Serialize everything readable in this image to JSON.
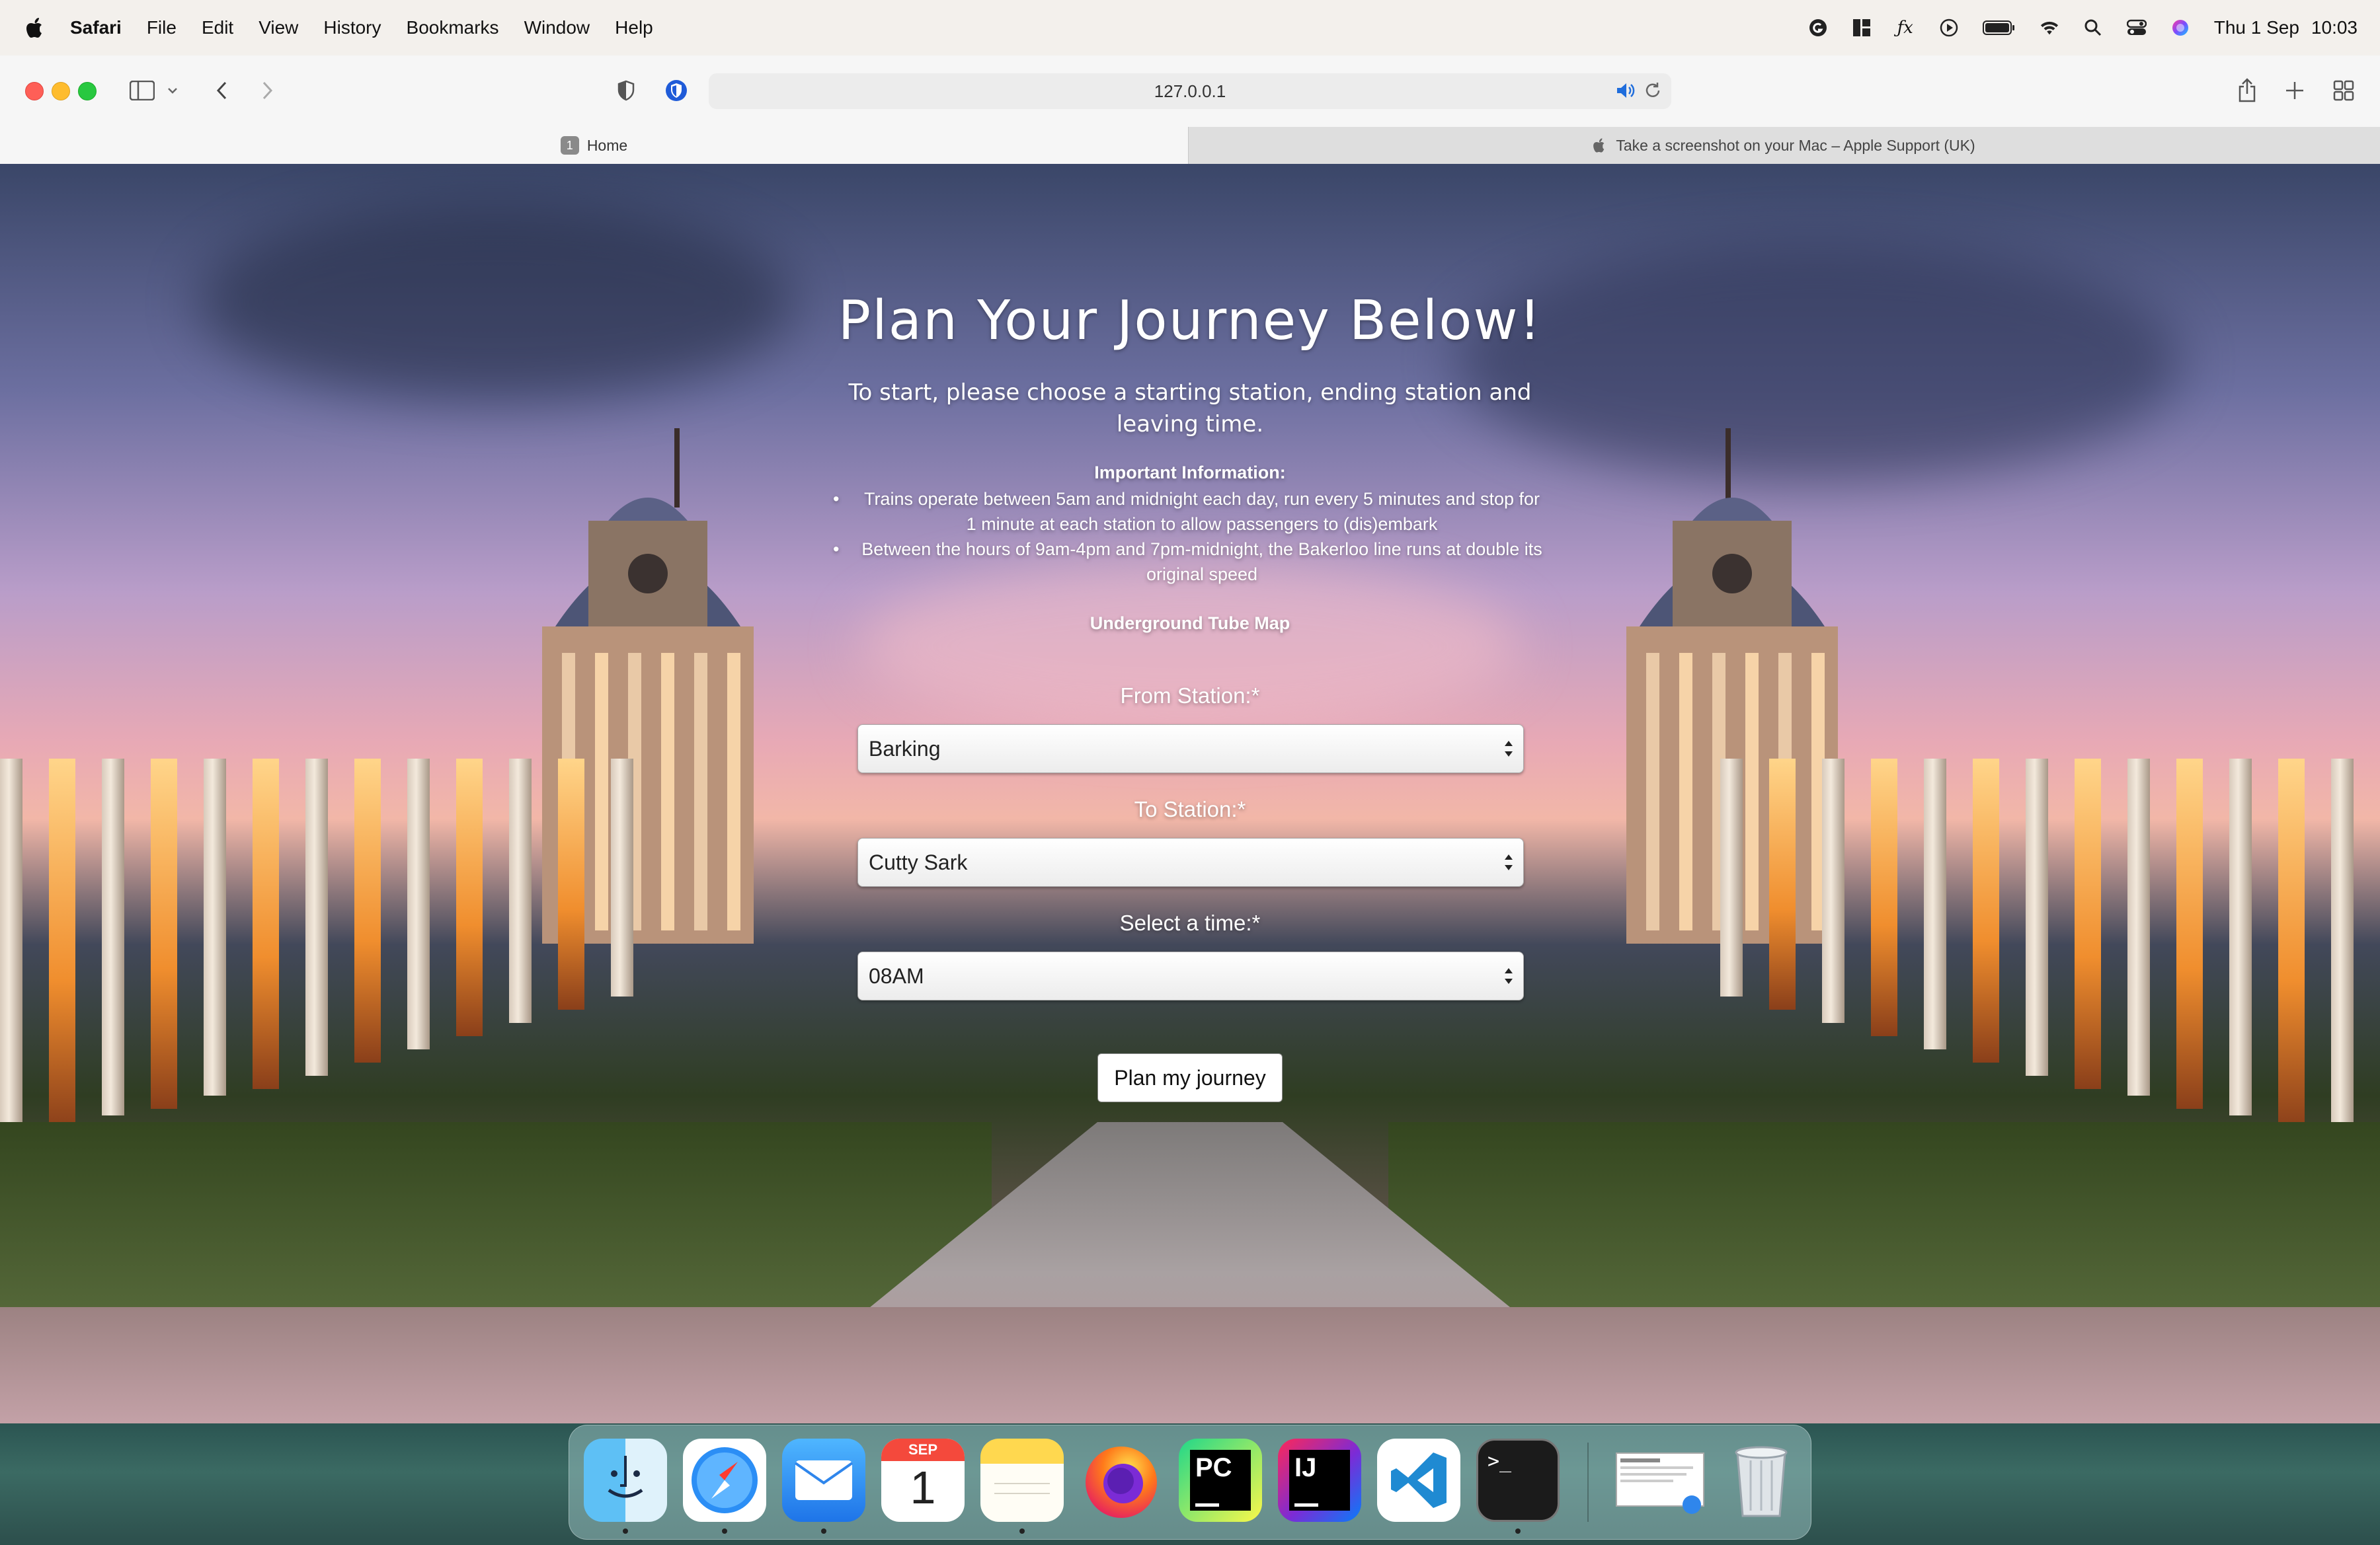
{
  "menubar": {
    "app_name": "Safari",
    "items": [
      "File",
      "Edit",
      "View",
      "History",
      "Bookmarks",
      "Window",
      "Help"
    ],
    "status_icons": [
      "grammarly-icon",
      "widgets-icon",
      "fx-icon",
      "play-icon",
      "battery-icon",
      "wifi-icon",
      "search-icon",
      "control-center-icon",
      "siri-icon"
    ],
    "date": "Thu 1 Sep",
    "time": "10:03"
  },
  "browser": {
    "url": "127.0.0.1",
    "tabs": [
      {
        "badge": "1",
        "label": "Home",
        "active": true
      },
      {
        "label": "Take a screenshot on your Mac – Apple Support (UK)",
        "active": false
      }
    ]
  },
  "page": {
    "heading": "Plan Your Journey Below!",
    "subtitle": "To start, please choose a starting station, ending station and leaving time.",
    "info_title": "Important Information:",
    "info_items": [
      "Trains operate between 5am and midnight each day, run every 5 minutes and stop for 1 minute at each station to allow passengers to (dis)embark",
      "Between the hours of 9am-4pm and 7pm-midnight, the Bakerloo line runs at double its original speed"
    ],
    "map_link": "Underground Tube Map",
    "form": {
      "from_label": "From Station:*",
      "from_value": "Barking",
      "to_label": "To Station:*",
      "to_value": "Cutty Sark",
      "time_label": "Select a time:*",
      "time_value": "08AM",
      "submit_label": "Plan my journey"
    }
  },
  "dock": {
    "apps": [
      "finder-icon",
      "safari-icon",
      "mail-icon",
      "calendar-icon",
      "notes-icon",
      "firefox-icon",
      "pycharm-icon",
      "intellij-icon",
      "vscode-icon",
      "terminal-icon",
      "preview-icon",
      "trash-icon"
    ],
    "calendar_month": "SEP",
    "calendar_day": "1",
    "pycharm_label": "PC",
    "intellij_label": "IJ"
  }
}
